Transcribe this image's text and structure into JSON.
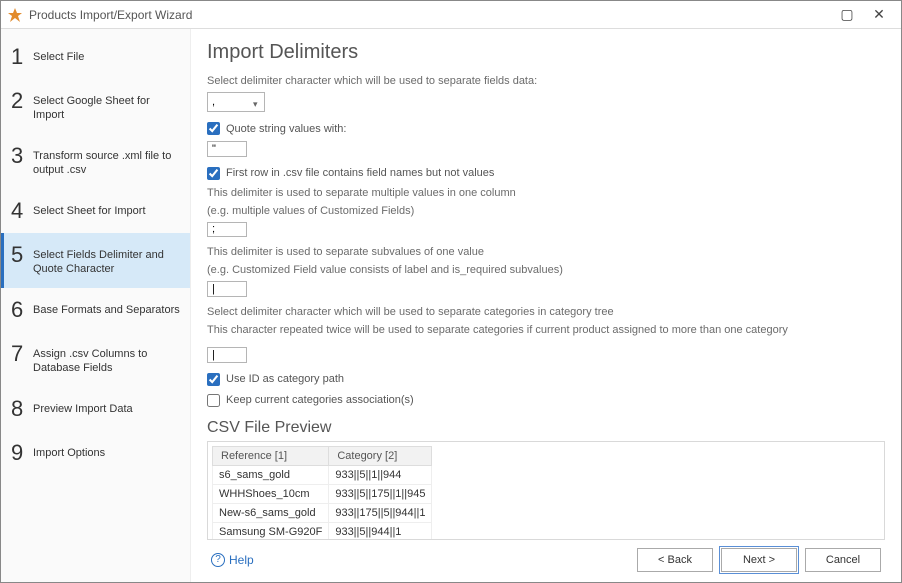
{
  "window": {
    "title": "Products Import/Export Wizard"
  },
  "steps": [
    {
      "num": "1",
      "label": "Select File"
    },
    {
      "num": "2",
      "label": "Select Google Sheet for Import"
    },
    {
      "num": "3",
      "label": "Transform source .xml file to output .csv"
    },
    {
      "num": "4",
      "label": "Select Sheet for Import"
    },
    {
      "num": "5",
      "label": "Select Fields Delimiter and Quote Character"
    },
    {
      "num": "6",
      "label": "Base Formats and Separators"
    },
    {
      "num": "7",
      "label": "Assign .csv Columns to Database Fields"
    },
    {
      "num": "8",
      "label": "Preview Import Data"
    },
    {
      "num": "9",
      "label": "Import Options"
    }
  ],
  "main": {
    "heading": "Import Delimiters",
    "desc1": "Select delimiter character which will be used to separate fields data:",
    "delimiterValue": ",",
    "quoteCheck": "Quote string values with:",
    "quoteValue": "\"",
    "firstRowCheck": "First row in .csv file contains field names but not values",
    "desc2a": "This delimiter is used to separate multiple values in one column",
    "desc2b": "(e.g. multiple values of Customized Fields)",
    "multiValue": ";",
    "desc3a": "This delimiter is used to separate subvalues of one value",
    "desc3b": "(e.g. Customized Field value consists of label and is_required subvalues)",
    "subValue": "|",
    "desc4a": "Select delimiter character which will be used to separate categories in category tree",
    "desc4b": "This character repeated twice will be used to separate categories if current product assigned to more than one category",
    "catValue": "|",
    "useIdCheck": "Use ID as category path",
    "keepCatCheck": "Keep current categories association(s)",
    "previewHeading": "CSV File Preview",
    "cols": {
      "c1": "Reference [1]",
      "c2": "Category [2]"
    },
    "rows": [
      {
        "r": "s6_sams_gold",
        "c": "933||5||1||944"
      },
      {
        "r": "WHHShoes_10cm",
        "c": "933||5||175||1||945"
      },
      {
        "r": "New-s6_sams_gold",
        "c": "933||175||5||944||1"
      },
      {
        "r": "Samsung SM-G920F",
        "c": "933||5||944||1"
      }
    ]
  },
  "footer": {
    "help": "Help",
    "back": "< Back",
    "next": "Next >",
    "cancel": "Cancel"
  }
}
